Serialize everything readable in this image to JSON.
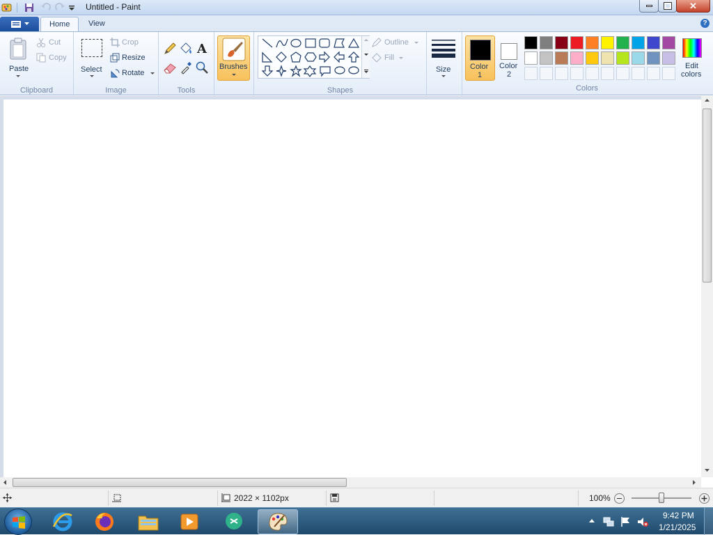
{
  "window": {
    "title": "Untitled - Paint"
  },
  "tabs": [
    {
      "label": "Home"
    },
    {
      "label": "View"
    }
  ],
  "clipboard": {
    "paste": "Paste",
    "cut": "Cut",
    "copy": "Copy",
    "group": "Clipboard"
  },
  "image": {
    "select": "Select",
    "crop": "Crop",
    "resize": "Resize",
    "rotate": "Rotate",
    "group": "Image"
  },
  "tools": {
    "group": "Tools"
  },
  "brushes": {
    "label": "Brushes"
  },
  "shapes": {
    "outline": "Outline",
    "fill": "Fill",
    "group": "Shapes"
  },
  "size": {
    "label": "Size"
  },
  "colors": {
    "color1_line1": "Color",
    "color1_line2": "1",
    "color2_line1": "Color",
    "color2_line2": "2",
    "edit_line1": "Edit",
    "edit_line2": "colors",
    "group": "Colors",
    "color1": "#000000",
    "color2": "#ffffff",
    "palette_row1": [
      "#000000",
      "#7f7f7f",
      "#880015",
      "#ed1c24",
      "#ff7f27",
      "#fff200",
      "#22b14c",
      "#00a2e8",
      "#3f48cc",
      "#a349a4"
    ],
    "palette_row2": [
      "#ffffff",
      "#c3c3c3",
      "#b97a57",
      "#ffaec9",
      "#ffc90e",
      "#efe4b0",
      "#b5e61d",
      "#99d9ea",
      "#7092be",
      "#c8bfe7"
    ]
  },
  "status": {
    "canvas_size": "2022 × 1102px",
    "zoom": "100%",
    "zoom_level": 0.5
  },
  "taskbar": {
    "time": "9:42 PM",
    "date": "1/21/2025"
  }
}
